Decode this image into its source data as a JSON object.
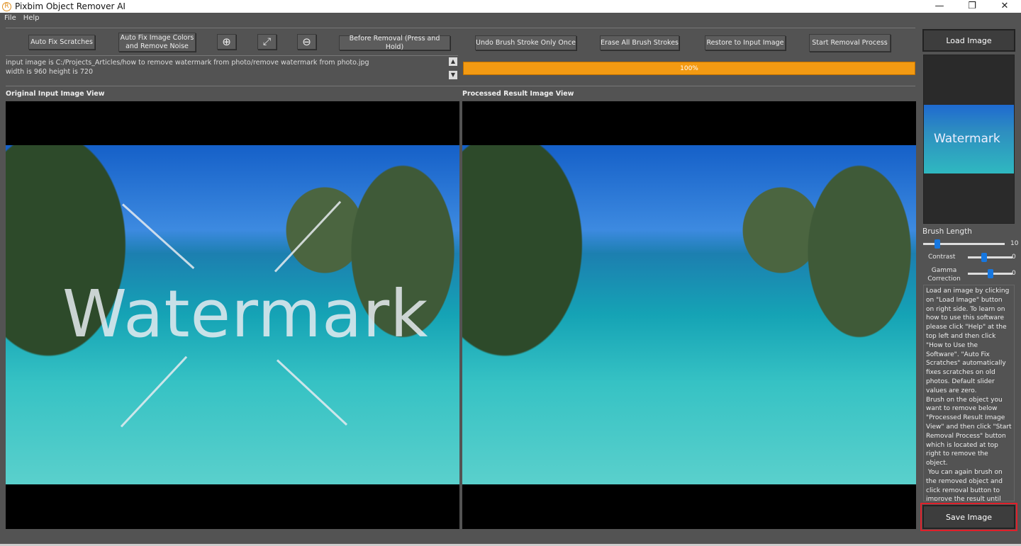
{
  "window": {
    "title": "Pixbim Object Remover AI",
    "logo_letter": "R",
    "minimize": "—",
    "maximize": "❐",
    "close": "✕"
  },
  "menu": [
    "File",
    "Help"
  ],
  "toolbar": {
    "auto_fix_scratches": "Auto Fix Scratches",
    "auto_fix_colors": "Auto Fix Image Colors and Remove Noise",
    "zoom_in_icon": "zoom-in-icon",
    "fit_icon": "expand-icon",
    "zoom_out_icon": "zoom-out-icon",
    "zoom_in": "⊕",
    "fit": "⤢",
    "zoom_out": "⊖",
    "before_removal": "Before Removal (Press and Hold)",
    "undo": "Undo Brush Stroke Only Once",
    "erase_all": "Erase All Brush Strokes",
    "restore": "Restore to Input Image",
    "start": "Start Removal Process"
  },
  "info": {
    "line1": "input image is C:/Projects_Articles/how to remove watermark from photo/remove watermark from photo.jpg",
    "line2": "width is 960 height is 720"
  },
  "progress": {
    "value": 100,
    "label": "100%",
    "color": "#f39a12"
  },
  "views": {
    "original_label": "Original Input Image View",
    "processed_label": "Processed Result Image View",
    "watermark_text": "Watermark"
  },
  "side": {
    "load": "Load Image",
    "save": "Save Image",
    "save_highlight": "#e0202a",
    "brush_label": "Brush Length",
    "brush_value": "10",
    "contrast_label": "Contrast",
    "contrast_value": "0",
    "gamma_label": "Gamma Correction",
    "gamma_value": "0",
    "help_text": "Load an image by clicking on \"Load Image\" button on right side. To learn on how to use this software please click \"Help\" at the top left and then click \"How to Use the Software\". \"Auto Fix Scratches\" automatically fixes scratches on old photos. Default slider values are zero.\nBrush on the object you want to remove below \"Processed Result Image View\" and then click \"Start Removal Process\" button which is located at top right to remove the object.\n You can again brush on the removed object and click removal button to improve the result until the object is removed completely.\npixbim.com"
  }
}
